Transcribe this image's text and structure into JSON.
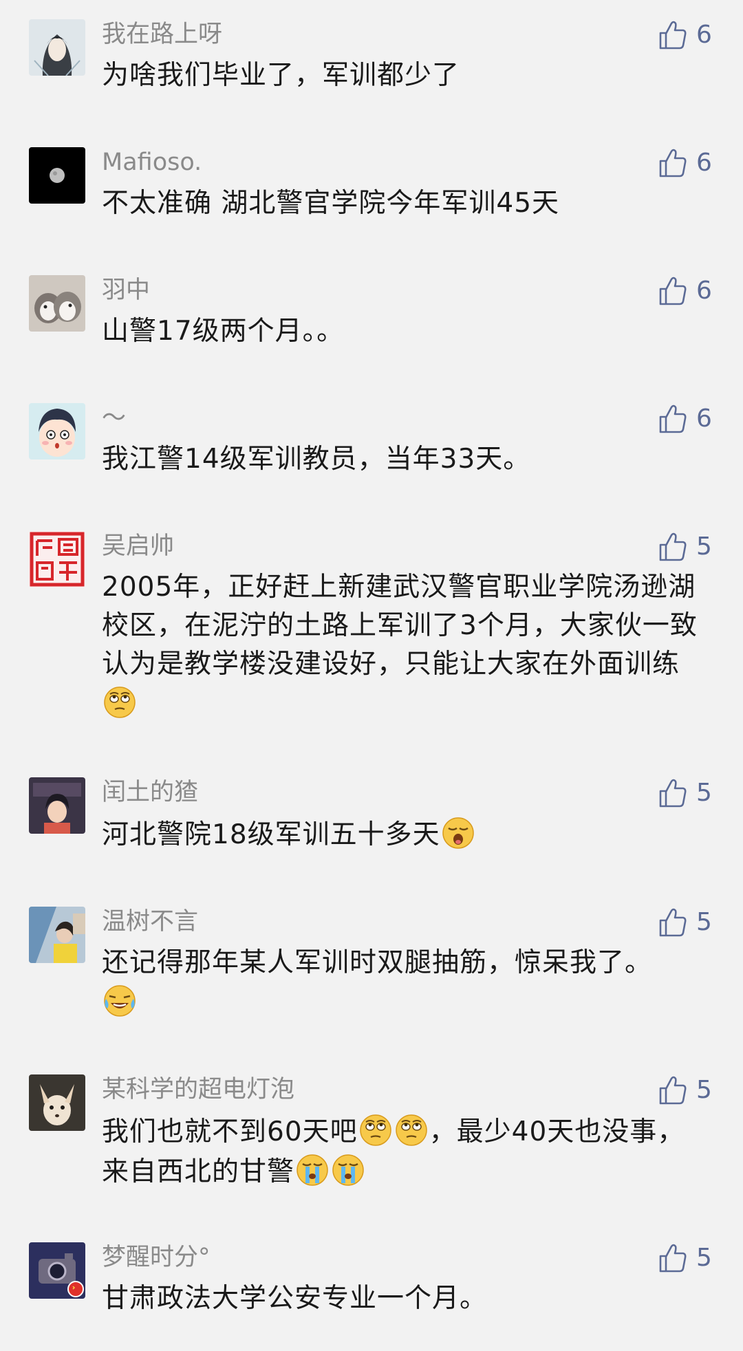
{
  "comments": [
    {
      "username": "我在路上呀",
      "text": "为啥我们毕业了，军训都少了",
      "likes": "6"
    },
    {
      "username": "Mafioso.",
      "text": "不太准确 湖北警官学院今年军训45天",
      "likes": "6"
    },
    {
      "username": "羽中",
      "text": "山警17级两个月。。",
      "likes": "6"
    },
    {
      "username": "～",
      "text": "我江警14级军训教员，当年33天。",
      "likes": "6"
    },
    {
      "username": "吴启帅",
      "text": "2005年，正好赶上新建武汉警官职业学院汤逊湖校区，在泥泞的土路上军训了3个月，大家伙一致认为是教学楼没建设好，只能让大家在外面训练",
      "likes": "5"
    },
    {
      "username": "闰土的猹",
      "text": "河北警院18级军训五十多天",
      "likes": "5"
    },
    {
      "username": "温树不言",
      "text": "还记得那年某人军训时双腿抽筋，惊呆我了。",
      "likes": "5"
    },
    {
      "username": "某科学的超电灯泡",
      "text_part1": "我们也就不到60天吧",
      "text_part2": "，最少40天也没事，来自西北的甘警",
      "likes": "5"
    },
    {
      "username": "梦醒时分°",
      "text": "甘肃政法大学公安专业一个月。",
      "likes": "5"
    }
  ],
  "icons": {
    "like": "thumbs-up-outline-icon",
    "emoji_eyeroll": "eye-roll-emoji-icon",
    "emoji_yawn": "yawn-emoji-icon",
    "emoji_laugh_cry": "laugh-cry-emoji-icon",
    "emoji_cry": "cry-emoji-icon"
  },
  "colors": {
    "background": "#f2f2f2",
    "username": "#8a8a8a",
    "text": "#1a1a1a",
    "like": "#5b6a95"
  }
}
